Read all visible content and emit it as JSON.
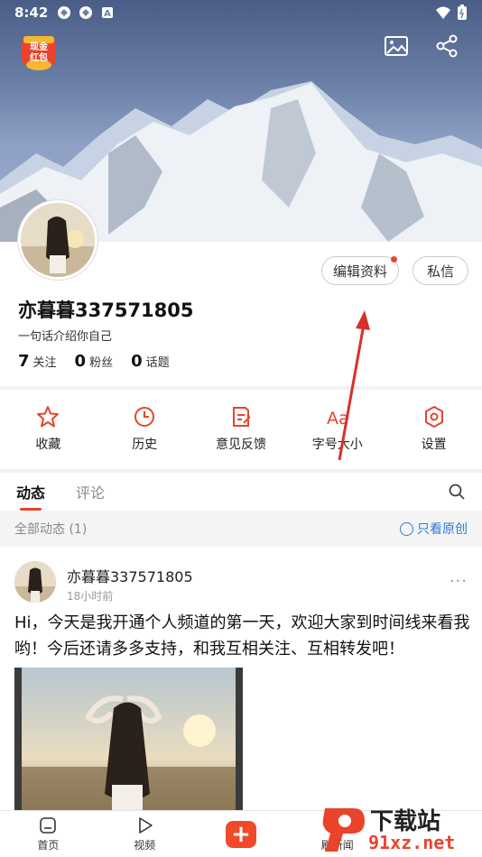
{
  "status_bar": {
    "time": "8:42"
  },
  "header": {
    "redpack_lines": [
      "现金",
      "红包"
    ]
  },
  "profile": {
    "edit_button": "编辑资料",
    "message_button": "私信",
    "username": "亦暮暮337571805",
    "bio": "一句话介绍你自己",
    "stats": [
      {
        "value": "7",
        "label": "关注"
      },
      {
        "value": "0",
        "label": "粉丝"
      },
      {
        "value": "0",
        "label": "话题"
      }
    ]
  },
  "tools": [
    {
      "label": "收藏",
      "icon": "star-icon"
    },
    {
      "label": "历史",
      "icon": "clock-icon"
    },
    {
      "label": "意见反馈",
      "icon": "edit-note-icon"
    },
    {
      "label": "字号大小",
      "icon": "font-size-icon"
    },
    {
      "label": "设置",
      "icon": "settings-icon"
    }
  ],
  "tabs": {
    "items": [
      "动态",
      "评论"
    ],
    "active": "动态"
  },
  "filter": {
    "all_label": "全部动态 (1)",
    "original_only": "只看原创"
  },
  "post": {
    "author": "亦暮暮337571805",
    "time": "18小时前",
    "more": "···",
    "text": "Hi，今天是我开通个人频道的第一天，欢迎大家到时间线来看我哟！今后还请多多支持，和我互相关注、互相转发吧！"
  },
  "bottom_nav": [
    {
      "label": "首页",
      "icon": "home-icon"
    },
    {
      "label": "视频",
      "icon": "play-icon"
    },
    {
      "label": "",
      "icon": "plus-icon"
    },
    {
      "label": "刷新闻",
      "icon": "news-icon"
    }
  ],
  "watermark": {
    "text": "下载站",
    "url": "91xz.net"
  },
  "colors": {
    "accent": "#e8442c",
    "link": "#2f7ad8"
  }
}
